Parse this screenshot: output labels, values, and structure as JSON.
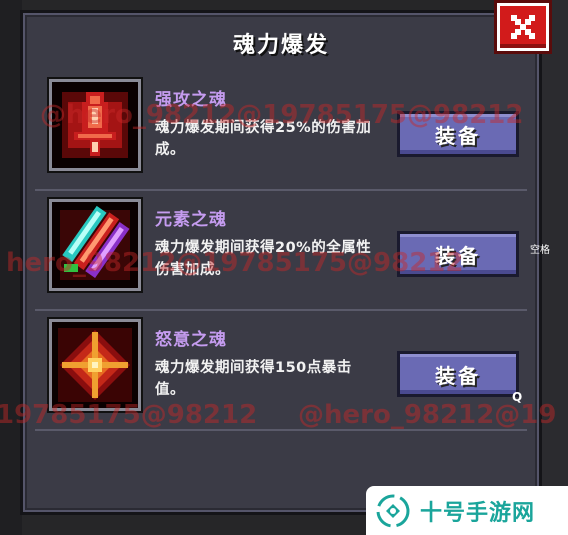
{
  "dialog": {
    "title": "魂力爆发",
    "close_label": "✕"
  },
  "souls": [
    {
      "name": "强攻之魂",
      "description": "魂力爆发期间获得25%的伤害加成。",
      "button_label": "装备",
      "icon": "sword-hilt-icon"
    },
    {
      "name": "元素之魂",
      "description": "魂力爆发期间获得20%的全属性伤害加成。",
      "button_label": "装备",
      "icon": "crystal-shards-icon"
    },
    {
      "name": "怒意之魂",
      "description": "魂力爆发期间获得150点暴击值。",
      "button_label": "装备",
      "icon": "crosshair-rune-icon"
    }
  ],
  "watermarks": [
    "@hero_98212@19785175@98212",
    "hero_98212@19785175@98212",
    "19785175@98212",
    "@hero_98212@19"
  ],
  "side_labels": {
    "right_label": "空格",
    "search_glyph": "Q"
  },
  "site_badge": {
    "text": "十号手游网",
    "logo": "site-logo-icon"
  },
  "colors": {
    "panel_bg": "#3b3b46",
    "name_text": "#c59cf0",
    "button_bg": "#6a6ab4",
    "close_bg": "#d21b1b",
    "watermark": "#c82828",
    "site_accent": "#1aa59b"
  }
}
